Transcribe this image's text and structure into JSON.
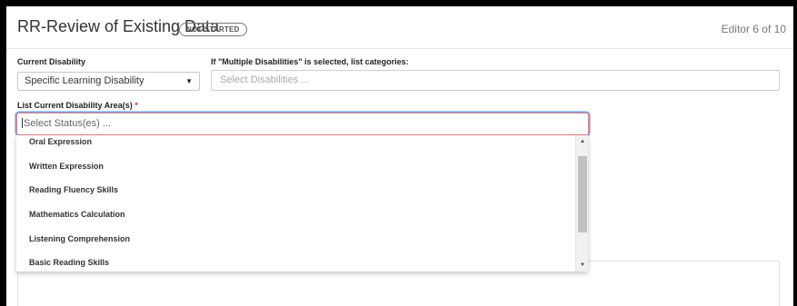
{
  "header": {
    "title": "RR-Review of Existing Data",
    "status_badge": "NOT STARTED",
    "editor_count": "Editor 6 of 10"
  },
  "current_disability": {
    "label": "Current Disability",
    "value": "Specific Learning Disability",
    "caret": "▼"
  },
  "multiple_disabilities": {
    "label": "If \"Multiple Disabilities\" is selected, list categories:",
    "placeholder": "Select Disabilities ..."
  },
  "disability_areas": {
    "label": "List Current Disability Area(s)",
    "required_mark": "*",
    "placeholder": "Select Status(es) ...",
    "options": [
      "Oral Expression",
      "Written Expression",
      "Reading Fluency Skills",
      "Mathematics Calculation",
      "Listening Comprehension",
      "Basic Reading Skills"
    ]
  },
  "scrollbar": {
    "up": "▲",
    "down": "▼"
  }
}
